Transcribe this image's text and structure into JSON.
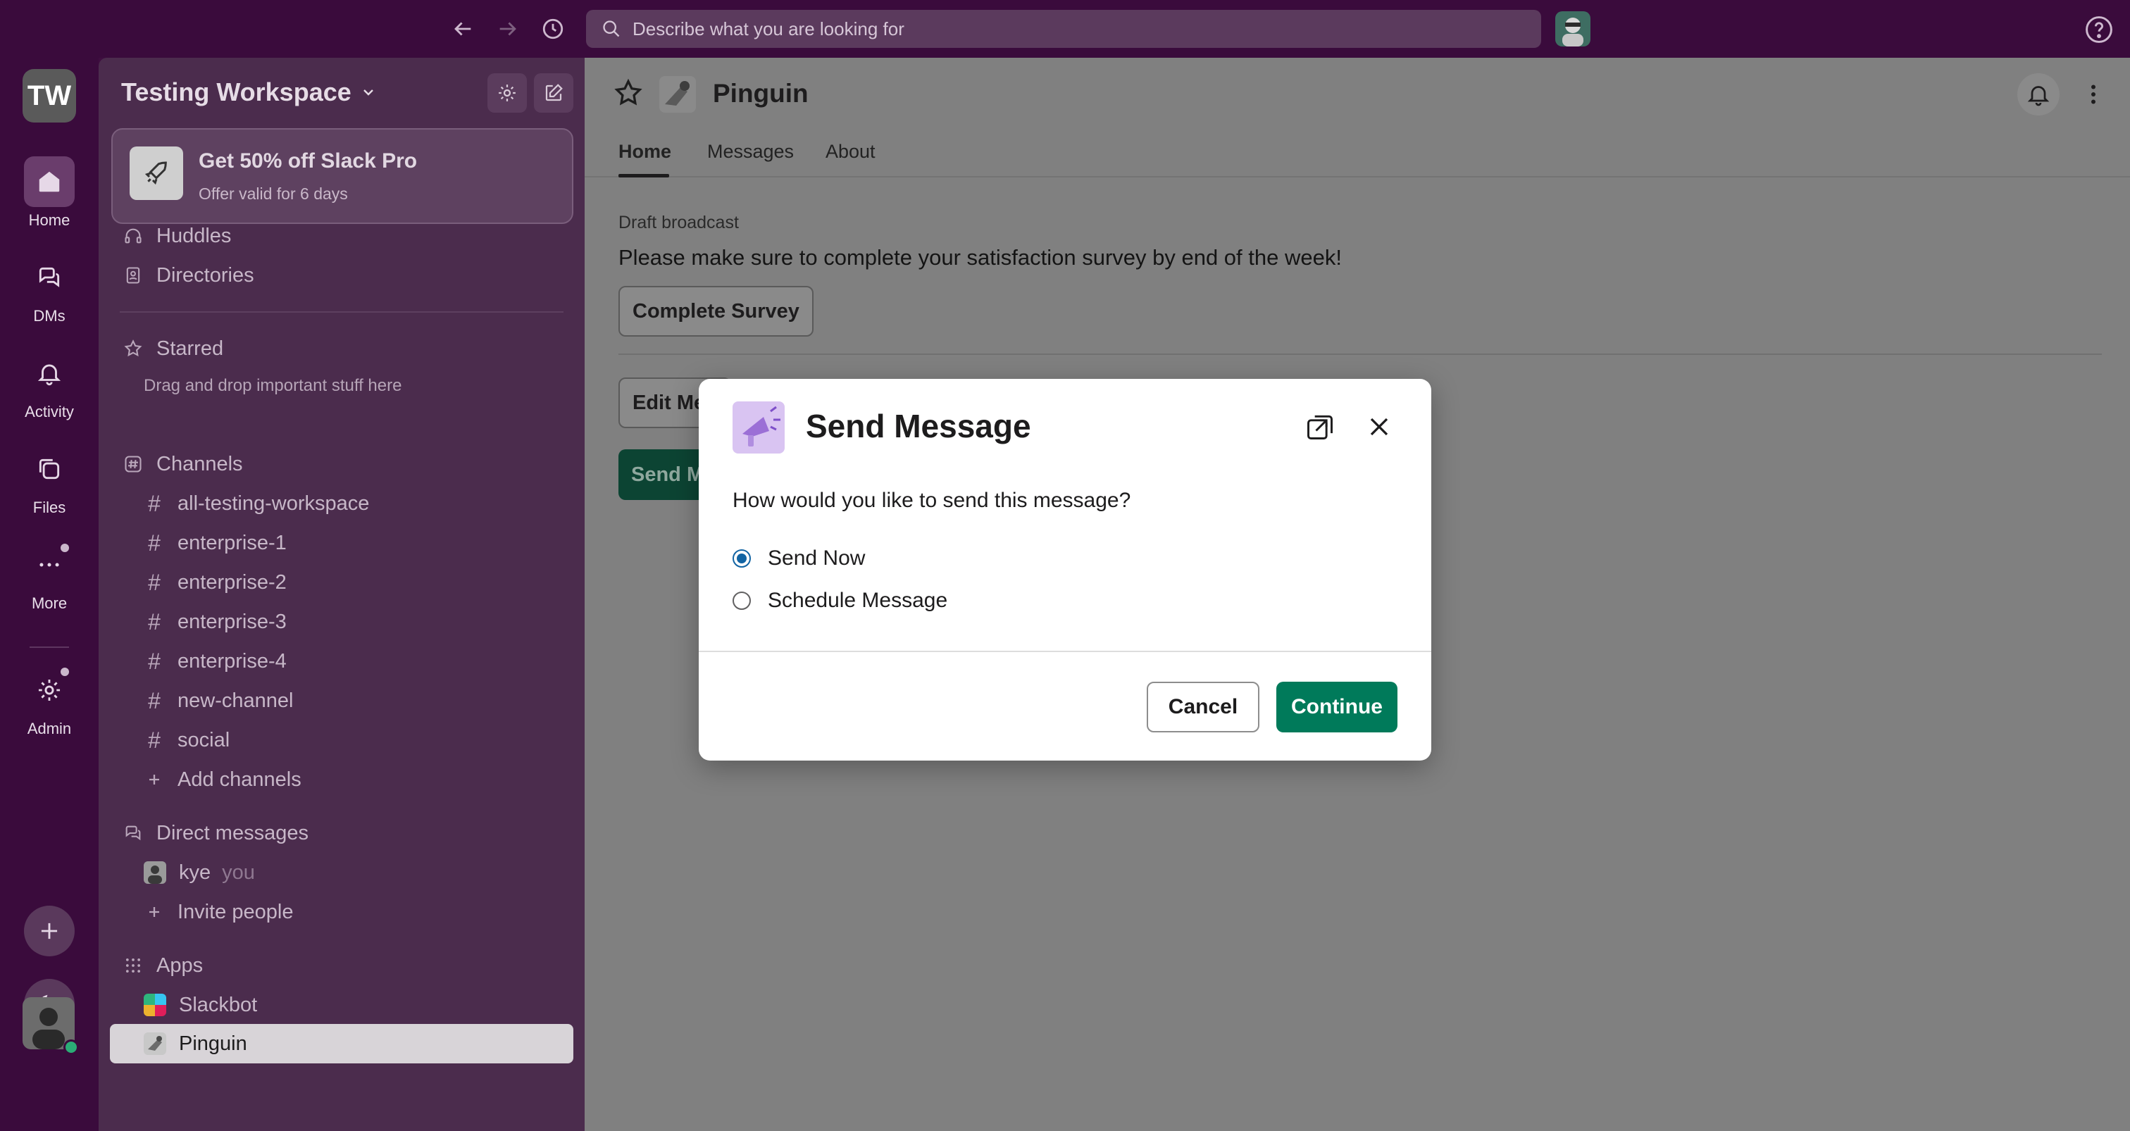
{
  "topbar": {
    "search_placeholder": "Describe what you are looking for"
  },
  "rail": {
    "workspace_initials": "TW",
    "items": [
      {
        "label": "Home",
        "icon": "home-icon"
      },
      {
        "label": "DMs",
        "icon": "dm-icon"
      },
      {
        "label": "Activity",
        "icon": "bell-icon"
      },
      {
        "label": "Files",
        "icon": "files-icon"
      },
      {
        "label": "More",
        "icon": "more-icon"
      },
      {
        "label": "Admin",
        "icon": "gear-icon"
      }
    ]
  },
  "sidebar": {
    "workspace_name": "Testing Workspace",
    "promo": {
      "title": "Get 50% off Slack Pro",
      "subtitle": "Offer valid for 6 days"
    },
    "nav": [
      {
        "label": "Huddles",
        "icon": "headphones-icon"
      },
      {
        "label": "Directories",
        "icon": "directory-icon"
      }
    ],
    "starred": {
      "label": "Starred",
      "hint": "Drag and drop important stuff here"
    },
    "channels": {
      "label": "Channels",
      "items": [
        "all-testing-workspace",
        "enterprise-1",
        "enterprise-2",
        "enterprise-3",
        "enterprise-4",
        "new-channel",
        "social"
      ],
      "add_label": "Add channels"
    },
    "dms": {
      "label": "Direct messages",
      "user": "kye",
      "you_tag": "you",
      "invite_label": "Invite people"
    },
    "apps": {
      "label": "Apps",
      "items": [
        "Slackbot",
        "Pinguin"
      ]
    }
  },
  "main": {
    "app_title": "Pinguin",
    "tabs": [
      "Home",
      "Messages",
      "About"
    ],
    "draft_label": "Draft broadcast",
    "draft_text": "Please make sure to complete your satisfaction survey by end of the week!",
    "survey_button": "Complete Survey",
    "edit_button": "Edit Me",
    "send_button": "Send M"
  },
  "modal": {
    "title": "Send Message",
    "question": "How would you like to send this message?",
    "options": [
      {
        "label": "Send Now",
        "checked": true
      },
      {
        "label": "Schedule Message",
        "checked": false
      }
    ],
    "cancel_label": "Cancel",
    "continue_label": "Continue",
    "accent_color": "#007a5a"
  }
}
